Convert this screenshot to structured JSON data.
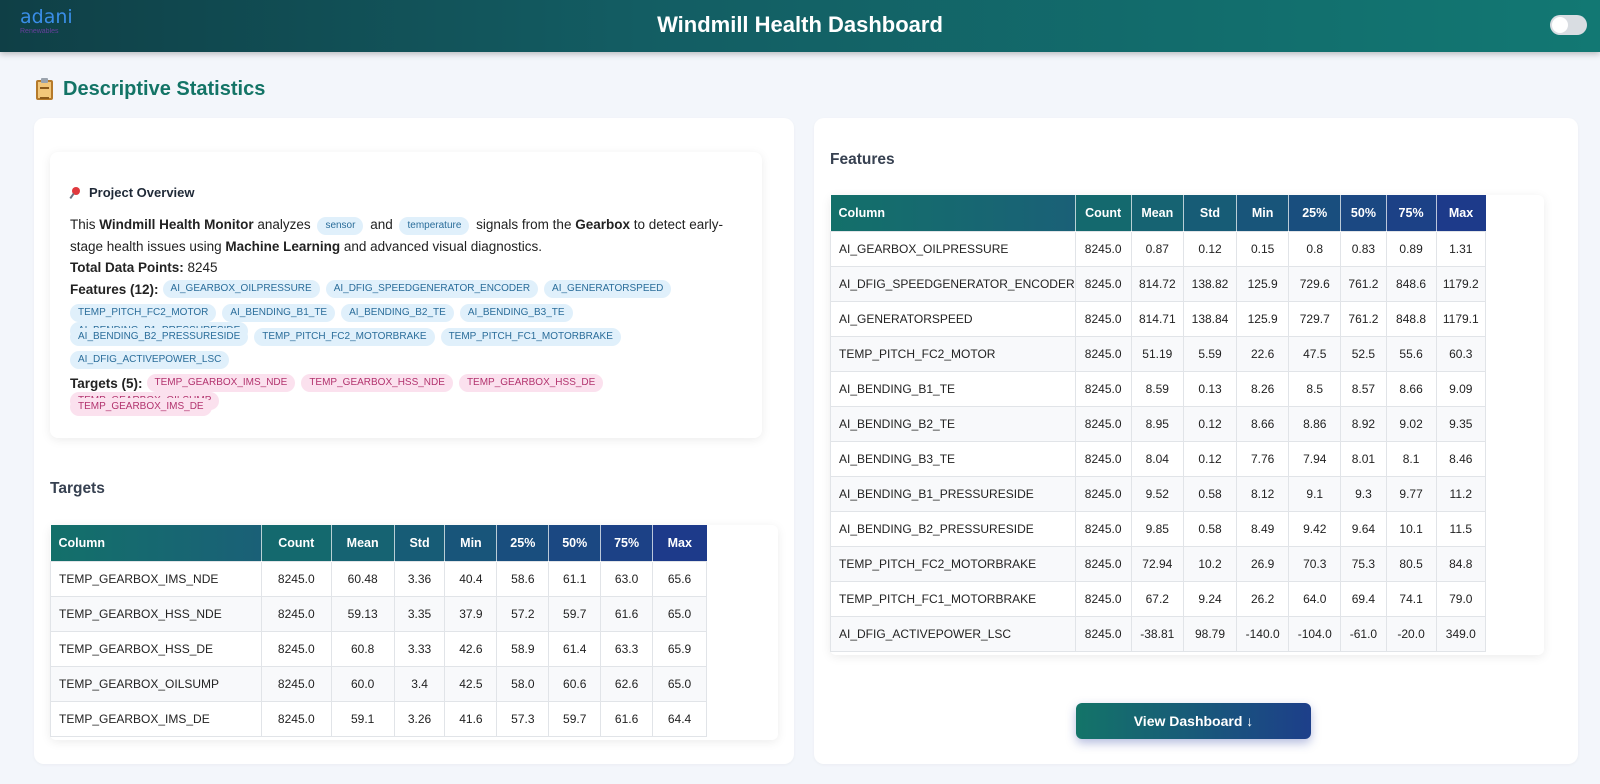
{
  "header": {
    "logo_text": "adani",
    "logo_sub": "Renewables",
    "title": "Windmill Health Dashboard"
  },
  "section": {
    "title": "Descriptive Statistics"
  },
  "overview": {
    "heading": "Project Overview",
    "intro_1": "This ",
    "monitor_name": "Windmill Health Monitor",
    "intro_2": " analyzes ",
    "chip_sensor": "sensor",
    "intro_3": " and ",
    "chip_temperature": "temperature",
    "intro_4": " signals from the ",
    "component": "Gearbox",
    "intro_5": " to detect early-stage health issues using ",
    "method": "Machine Learning",
    "intro_6": " and advanced visual diagnostics.",
    "total_label": "Total Data Points:",
    "total_value": "8245",
    "features_label": "Features (12):",
    "features": [
      "AI_GEARBOX_OILPRESSURE",
      "AI_DFIG_SPEEDGENERATOR_ENCODER",
      "AI_GENERATORSPEED",
      "TEMP_PITCH_FC2_MOTOR",
      "AI_BENDING_B1_TE",
      "AI_BENDING_B2_TE",
      "AI_BENDING_B3_TE",
      "AI_BENDING_B1_PRESSURESIDE",
      "AI_BENDING_B2_PRESSURESIDE",
      "TEMP_PITCH_FC2_MOTORBRAKE",
      "TEMP_PITCH_FC1_MOTORBRAKE",
      "AI_DFIG_ACTIVEPOWER_LSC"
    ],
    "targets_label": "Targets (5):",
    "targets": [
      "TEMP_GEARBOX_IMS_NDE",
      "TEMP_GEARBOX_HSS_NDE",
      "TEMP_GEARBOX_HSS_DE",
      "TEMP_GEARBOX_OILSUMP",
      "TEMP_GEARBOX_IMS_DE"
    ]
  },
  "targets_table": {
    "title": "Targets",
    "headers": [
      "Column",
      "Count",
      "Mean",
      "Std",
      "Min",
      "25%",
      "50%",
      "75%",
      "Max"
    ],
    "rows": [
      [
        "TEMP_GEARBOX_IMS_NDE",
        "8245.0",
        "60.48",
        "3.36",
        "40.4",
        "58.6",
        "61.1",
        "63.0",
        "65.6"
      ],
      [
        "TEMP_GEARBOX_HSS_NDE",
        "8245.0",
        "59.13",
        "3.35",
        "37.9",
        "57.2",
        "59.7",
        "61.6",
        "65.0"
      ],
      [
        "TEMP_GEARBOX_HSS_DE",
        "8245.0",
        "60.8",
        "3.33",
        "42.6",
        "58.9",
        "61.4",
        "63.3",
        "65.9"
      ],
      [
        "TEMP_GEARBOX_OILSUMP",
        "8245.0",
        "60.0",
        "3.4",
        "42.5",
        "58.0",
        "60.6",
        "62.6",
        "65.0"
      ],
      [
        "TEMP_GEARBOX_IMS_DE",
        "8245.0",
        "59.1",
        "3.26",
        "41.6",
        "57.3",
        "59.7",
        "61.6",
        "64.4"
      ]
    ]
  },
  "features_table": {
    "title": "Features",
    "headers": [
      "Column",
      "Count",
      "Mean",
      "Std",
      "Min",
      "25%",
      "50%",
      "75%",
      "Max"
    ],
    "rows": [
      [
        "AI_GEARBOX_OILPRESSURE",
        "8245.0",
        "0.87",
        "0.12",
        "0.15",
        "0.8",
        "0.83",
        "0.89",
        "1.31"
      ],
      [
        "AI_DFIG_SPEEDGENERATOR_ENCODER",
        "8245.0",
        "814.72",
        "138.82",
        "125.9",
        "729.6",
        "761.2",
        "848.6",
        "1179.2"
      ],
      [
        "AI_GENERATORSPEED",
        "8245.0",
        "814.71",
        "138.84",
        "125.9",
        "729.7",
        "761.2",
        "848.8",
        "1179.1"
      ],
      [
        "TEMP_PITCH_FC2_MOTOR",
        "8245.0",
        "51.19",
        "5.59",
        "22.6",
        "47.5",
        "52.5",
        "55.6",
        "60.3"
      ],
      [
        "AI_BENDING_B1_TE",
        "8245.0",
        "8.59",
        "0.13",
        "8.26",
        "8.5",
        "8.57",
        "8.66",
        "9.09"
      ],
      [
        "AI_BENDING_B2_TE",
        "8245.0",
        "8.95",
        "0.12",
        "8.66",
        "8.86",
        "8.92",
        "9.02",
        "9.35"
      ],
      [
        "AI_BENDING_B3_TE",
        "8245.0",
        "8.04",
        "0.12",
        "7.76",
        "7.94",
        "8.01",
        "8.1",
        "8.46"
      ],
      [
        "AI_BENDING_B1_PRESSURESIDE",
        "8245.0",
        "9.52",
        "0.58",
        "8.12",
        "9.1",
        "9.3",
        "9.77",
        "11.2"
      ],
      [
        "AI_BENDING_B2_PRESSURESIDE",
        "8245.0",
        "9.85",
        "0.58",
        "8.49",
        "9.42",
        "9.64",
        "10.1",
        "11.5"
      ],
      [
        "TEMP_PITCH_FC2_MOTORBRAKE",
        "8245.0",
        "72.94",
        "10.2",
        "26.9",
        "70.3",
        "75.3",
        "80.5",
        "84.8"
      ],
      [
        "TEMP_PITCH_FC1_MOTORBRAKE",
        "8245.0",
        "67.2",
        "9.24",
        "26.2",
        "64.0",
        "69.4",
        "74.1",
        "79.0"
      ],
      [
        "AI_DFIG_ACTIVEPOWER_LSC",
        "8245.0",
        "-38.81",
        "98.79",
        "-140.0",
        "-104.0",
        "-61.0",
        "-20.0",
        "349.0"
      ]
    ]
  },
  "button": {
    "label": "View Dashboard ↓"
  },
  "colors": {
    "header_start": "#0f3f46",
    "header_end": "#127873",
    "accent": "#137466",
    "table_header_start": "#13706a",
    "table_header_end": "#1d3a8a"
  }
}
